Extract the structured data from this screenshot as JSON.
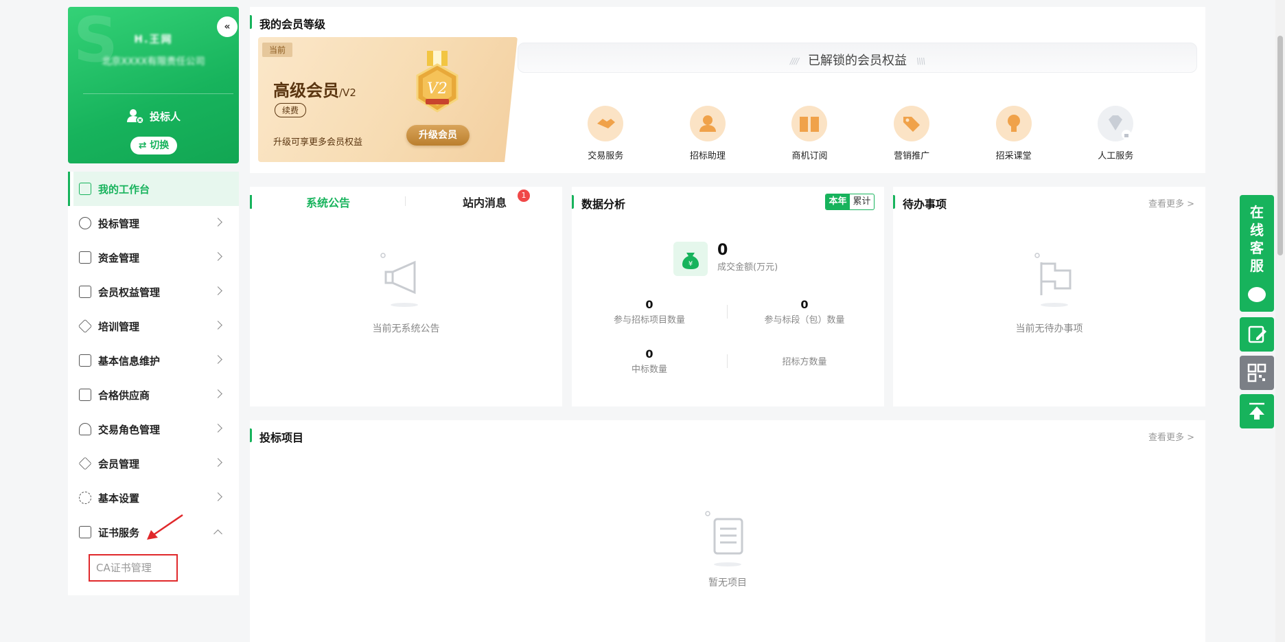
{
  "profile": {
    "name": "H.王网",
    "company": "北京XXXX有限责任公司",
    "role": "投标人",
    "switch_label": "⇄ 切换",
    "collapse_symbol": "«"
  },
  "menu": {
    "items": [
      {
        "label": "我的工作台",
        "icon": "chart-line-icon"
      },
      {
        "label": "投标管理",
        "icon": "target-icon"
      },
      {
        "label": "资金管理",
        "icon": "yen-doc-icon"
      },
      {
        "label": "会员权益管理",
        "icon": "book-icon"
      },
      {
        "label": "培训管理",
        "icon": "graduation-cap-icon"
      },
      {
        "label": "基本信息维护",
        "icon": "document-icon"
      },
      {
        "label": "合格供应商",
        "icon": "yen-doc-icon"
      },
      {
        "label": "交易角色管理",
        "icon": "user-gear-icon"
      },
      {
        "label": "会员管理",
        "icon": "diamond-icon"
      },
      {
        "label": "基本设置",
        "icon": "gear-icon"
      },
      {
        "label": "证书服务",
        "icon": "certificate-icon"
      }
    ],
    "submenu_label": "CA证书管理"
  },
  "membership": {
    "section_title": "我的会员等级",
    "current_tag": "当前",
    "level_name": "高级会员",
    "level_code": "/V2",
    "renew_label": "续费",
    "upgrade_hint": "升级可享更多会员权益",
    "upgrade_button": "升级会员",
    "medal_text": "V2",
    "unlocked_title": "已解锁的会员权益",
    "benefits": [
      {
        "label": "交易服务",
        "icon": "handshake-icon",
        "locked": false
      },
      {
        "label": "招标助理",
        "icon": "assistant-icon",
        "locked": false
      },
      {
        "label": "商机订阅",
        "icon": "book-open-icon",
        "locked": false
      },
      {
        "label": "营销推广",
        "icon": "tag-icon",
        "locked": false
      },
      {
        "label": "招采课堂",
        "icon": "lightbulb-icon",
        "locked": false
      },
      {
        "label": "人工服务",
        "icon": "diamond-icon",
        "locked": true
      }
    ]
  },
  "notices": {
    "tab_system": "系统公告",
    "tab_messages": "站内消息",
    "message_badge": "1",
    "empty_text": "当前无系统公告"
  },
  "data_analysis": {
    "title": "数据分析",
    "toggle_on": "本年",
    "toggle_off": "累计",
    "deal_amount_value": "0",
    "deal_amount_label": "成交金额(万元)",
    "stats": [
      {
        "value": "0",
        "label": "参与招标项目数量"
      },
      {
        "value": "0",
        "label": "参与标段（包）数量"
      },
      {
        "value": "0",
        "label": "中标数量"
      },
      {
        "value": "",
        "label": "招标方数量"
      }
    ]
  },
  "todo": {
    "title": "待办事项",
    "view_more": "查看更多 >",
    "empty_text": "当前无待办事项"
  },
  "projects": {
    "title": "投标项目",
    "view_more": "查看更多 >",
    "empty_text": "暂无项目"
  },
  "float_service": {
    "label": "在线客服"
  },
  "colors": {
    "brand_green": "#17b35c",
    "badge_red": "#f04848",
    "gold": "#bb7f2e",
    "annotation_red": "#e0282b"
  }
}
